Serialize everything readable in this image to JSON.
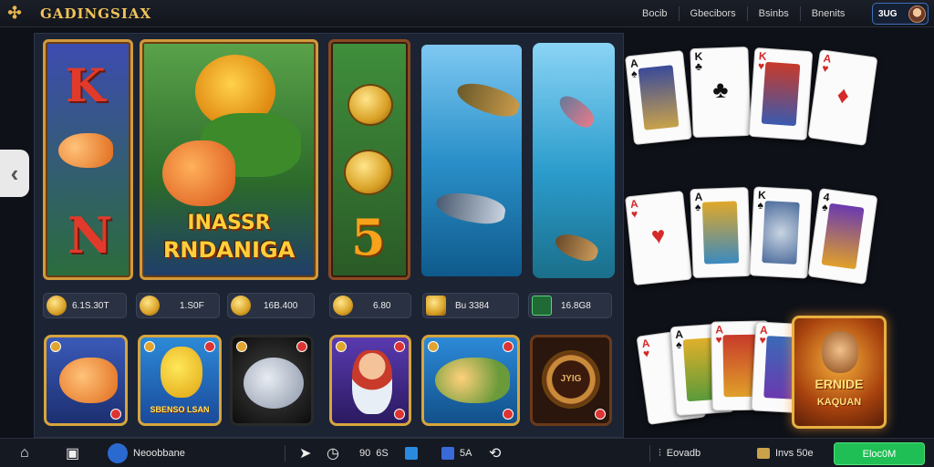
{
  "header": {
    "brand": "GADINGSIAX",
    "nav": [
      "Bocib",
      "Gbecibors",
      "Bsinbs",
      "Bnenits"
    ],
    "user_label": "3UG"
  },
  "tiles": {
    "slot_letters": [
      "K",
      "N"
    ],
    "featured_title_1": "INASSR",
    "featured_title_2": "RNDANIGA",
    "slot_number": "5"
  },
  "stats": [
    {
      "value": "6.1S.30T"
    },
    {
      "value": "1.S0F"
    },
    {
      "value": "16B.400"
    },
    {
      "value": "6.80"
    },
    {
      "value": "Bu 3384"
    },
    {
      "value": "16.8G8"
    }
  ],
  "icon_tiles": {
    "banner_label": "SBENSO LSAN",
    "coin_label": "JYIG"
  },
  "promo": {
    "line1": "ERNIDE",
    "line2": "KAQUAN"
  },
  "bottombar": {
    "profile_label": "Neoobbane",
    "counter_1": "90",
    "counter_1b": "6S",
    "counter_2": "5A",
    "stat_label_1": "Eovadb",
    "stat_label_2": "Invs 50e",
    "cta_label": "Eloc0M"
  },
  "colors": {
    "accent_gold": "#f0c35a",
    "cta_green": "#1fbf55",
    "background": "#0e1118"
  }
}
